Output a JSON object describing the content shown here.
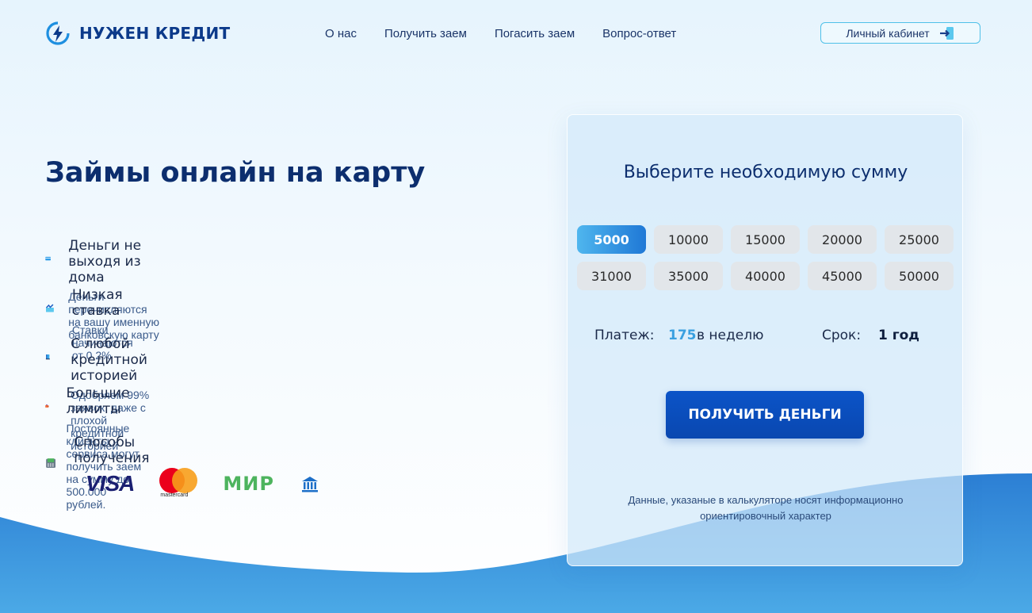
{
  "header": {
    "logo_text": "НУЖЕН КРЕДИТ",
    "nav": [
      {
        "label": "О нас"
      },
      {
        "label": "Получить заем"
      },
      {
        "label": "Погасить заем"
      },
      {
        "label": "Вопрос-ответ"
      }
    ],
    "cabinet_label": "Личный кабинет"
  },
  "hero": {
    "title": "Займы онлайн на карту",
    "features": [
      {
        "title": "Деньги не выходя из дома",
        "desc": "Деньги перечисляются на вашу именную банковскую карту",
        "icon": "credit-card-icon"
      },
      {
        "title": "Низкая ставка",
        "desc": "Ставки начинаются от 0,2%",
        "icon": "chart-down-icon"
      },
      {
        "title": "С любой кредитной историей",
        "desc": "Одобряем 99% заявок, даже с плохой кредитной историей",
        "icon": "book-icon"
      },
      {
        "title": "Большие лимиты",
        "desc": "Постоянные клиенты сервиса могут получить заем на сумму до 500.000 рублей.",
        "icon": "wallet-icon"
      },
      {
        "title": "Способы получения",
        "desc": "",
        "icon": "payment-terminal-icon"
      }
    ],
    "payment_methods": {
      "visa": "VISA",
      "mastercard": "mastercard",
      "mir": "МИР",
      "bank_icon": "bank-icon"
    }
  },
  "calculator": {
    "title": "Выберите необходимую сумму",
    "amounts": [
      "5000",
      "10000",
      "15000",
      "20000",
      "25000",
      "31000",
      "35000",
      "40000",
      "45000",
      "50000"
    ],
    "selected_amount": "5000",
    "payment_label": "Платеж:",
    "payment_value": "175",
    "payment_unit": "в неделю",
    "term_label": "Срок:",
    "term_value": "1 год",
    "cta_label": "ПОЛУЧИТЬ ДЕНЬГИ",
    "disclaimer": "Данные, указаные в калькуляторе носят информационно ориентировочный характер"
  },
  "colors": {
    "brand_dark": "#0c3a8a",
    "accent_blue": "#1f78d6",
    "cta_blue": "#0b54c8",
    "payment_value": "#3aa0e0"
  }
}
